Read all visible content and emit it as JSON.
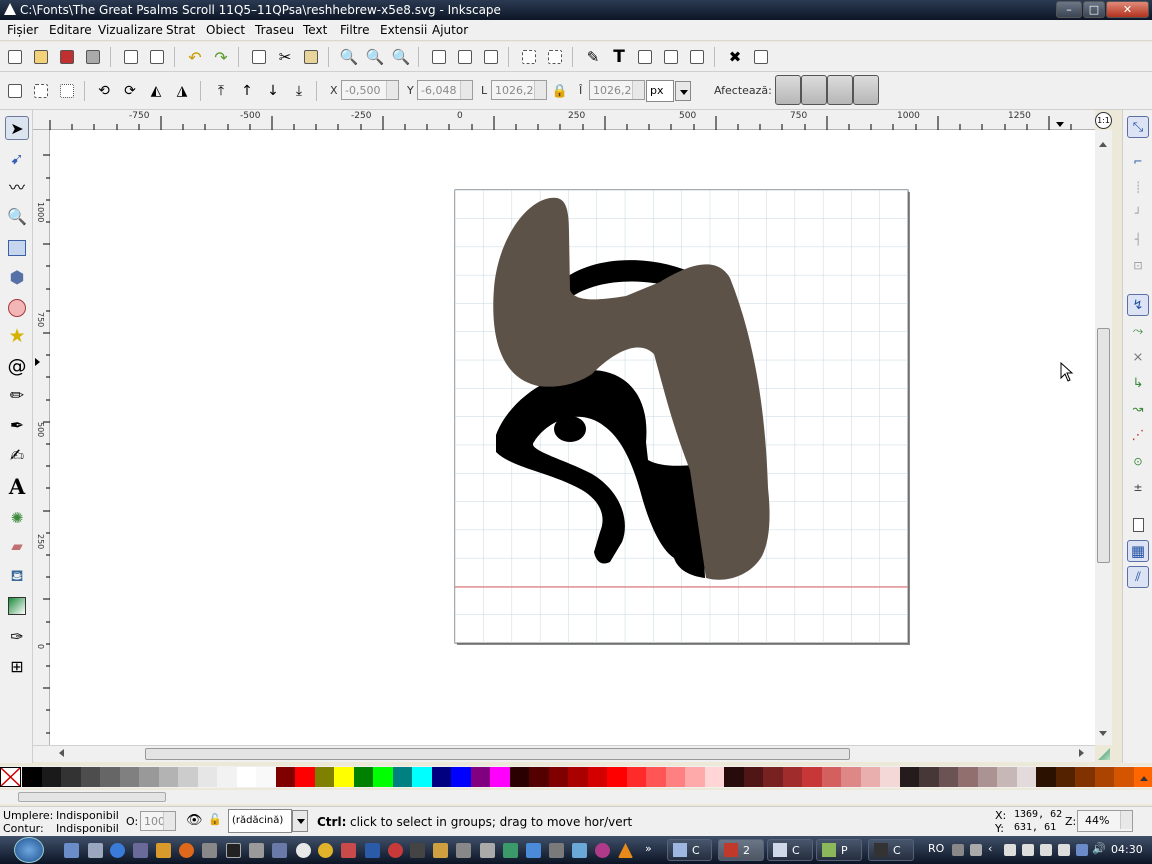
{
  "window": {
    "title": "C:\\Fonts\\The Great Psalms Scroll 11Q5–11QPsa\\reshhebrew-x5e8.svg - Inkscape",
    "controls": [
      "–",
      "□",
      "✕"
    ]
  },
  "menu": [
    "Fișier",
    "Editare",
    "Vizualizare",
    "Strat",
    "Obiect",
    "Traseu",
    "Text",
    "Filtre",
    "Extensii",
    "Ajutor"
  ],
  "toolbar": {
    "commands": [
      "new-icon",
      "open-icon",
      "save-icon",
      "print-icon",
      "import-icon",
      "export-icon",
      "undo-icon",
      "redo-icon",
      "copy-icon",
      "cut-icon",
      "paste-icon",
      "zoom-selection-icon",
      "zoom-drawing-icon",
      "zoom-page-icon",
      "duplicate-icon",
      "clone-icon",
      "unlink-clone-icon",
      "group-icon",
      "ungroup-icon",
      "fill-stroke-icon",
      "text-tool-icon",
      "layers-icon",
      "xml-editor-icon",
      "align-icon",
      "preferences-icon",
      "document-properties-icon"
    ]
  },
  "selector_controls": {
    "x_label": "X",
    "x_value": "-0,500",
    "y_label": "Y",
    "y_value": "-6,048",
    "w_label": "L",
    "w_value": "1026,23",
    "h_label": "Î",
    "h_value": "1026,23",
    "unit": "px",
    "affect_label": "Afectează:"
  },
  "ruler": {
    "h_ticks": [
      "-750",
      "-500",
      "-250",
      "0",
      "250",
      "500",
      "750",
      "1000",
      "1250"
    ],
    "v_ticks": [
      "1000",
      "750",
      "500",
      "250",
      "0"
    ]
  },
  "tools": [
    "selector-tool-icon",
    "node-tool-icon",
    "tweak-tool-icon",
    "zoom-tool-icon",
    "rectangle-tool-icon",
    "3d-box-tool-icon",
    "ellipse-tool-icon",
    "star-tool-icon",
    "spiral-tool-icon",
    "pencil-tool-icon",
    "pen-tool-icon",
    "calligraphy-tool-icon",
    "text-tool-icon",
    "spray-tool-icon",
    "eraser-tool-icon",
    "paint-bucket-tool-icon",
    "gradient-tool-icon",
    "dropper-tool-icon",
    "connector-tool-icon"
  ],
  "palette": [
    "#000000",
    "#1a1a1a",
    "#333333",
    "#4d4d4d",
    "#666666",
    "#808080",
    "#999999",
    "#b3b3b3",
    "#cccccc",
    "#e6e6e6",
    "#f2f2f2",
    "#ffffff",
    "#f9f9f9",
    "#800000",
    "#ff0000",
    "#808000",
    "#ffff00",
    "#008000",
    "#00ff00",
    "#008080",
    "#00ffff",
    "#000080",
    "#0000ff",
    "#800080",
    "#ff00ff",
    "#2b0000",
    "#550000",
    "#800000",
    "#aa0000",
    "#d40000",
    "#ff0000",
    "#ff2a2a",
    "#ff5555",
    "#ff8080",
    "#ffaaaa",
    "#ffd5d5",
    "#280b0b",
    "#501616",
    "#782121",
    "#a02c2c",
    "#c83737",
    "#d35f5f",
    "#de8787",
    "#e9afaf",
    "#f4d7d7",
    "#241c1c",
    "#483737",
    "#6c5353",
    "#916f6f",
    "#ac9393",
    "#c8b7b7",
    "#e3dbdb",
    "#2b1100",
    "#552200",
    "#803300",
    "#aa4400",
    "#d45500",
    "#ff6600"
  ],
  "status": {
    "fill_label": "Umplere:",
    "fill_value": "Indisponibil",
    "stroke_label": "Contur:",
    "stroke_value": "Indisponibil",
    "opacity_label": "O:",
    "opacity_value": "100",
    "layer": "(rădăcină)",
    "message_key": "Ctrl:",
    "message": " click to select in groups; drag to move hor/vert",
    "x_label": "X:",
    "x_value": "1369, 62",
    "y_label": "Y:",
    "y_value": "631, 61",
    "zoom_label": "Z:",
    "zoom_value": "44%"
  },
  "taskbar": {
    "apps": [
      {
        "label": "C",
        "icon": "folder-icon"
      },
      {
        "label": "2",
        "icon": "inkscape-icon"
      },
      {
        "label": "C",
        "icon": "notepad-icon"
      },
      {
        "label": "P",
        "icon": "paint-icon"
      },
      {
        "label": "C",
        "icon": "inkscape-icon"
      }
    ],
    "language": "RO",
    "clock": "04:30"
  },
  "colors": {
    "letter_fill": "#5d5248",
    "stroke": "#000000",
    "grid": "#c5d7e1",
    "guide": "#e06060",
    "selected_tool": "#dce4f0"
  }
}
